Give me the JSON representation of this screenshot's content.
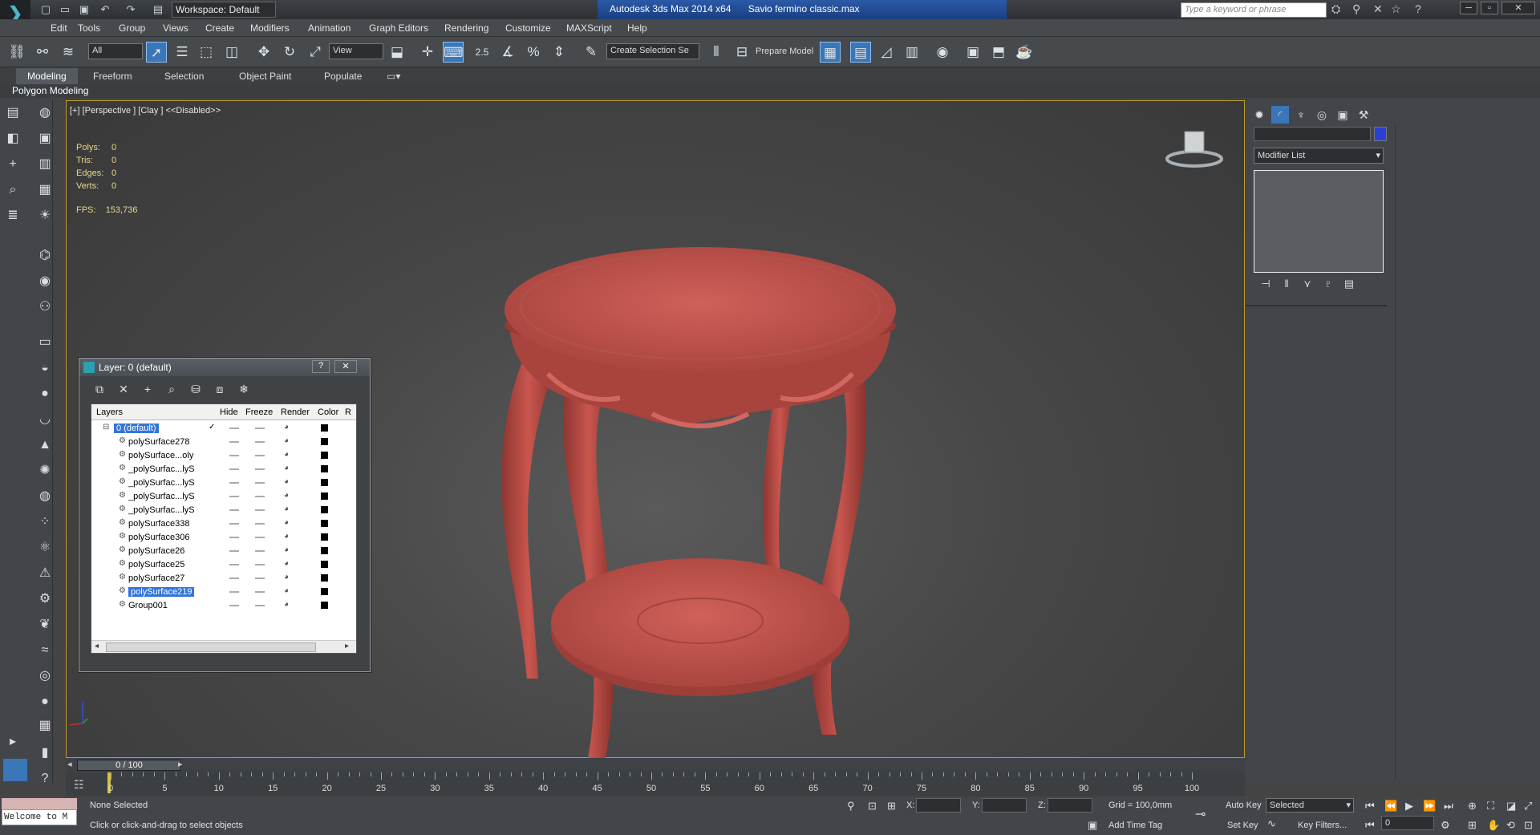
{
  "window": {
    "app_title": "Autodesk 3ds Max  2014 x64",
    "file_name": "Savio fermino classic.max",
    "workspace": "Workspace: Default",
    "search_placeholder": "Type a keyword or phrase"
  },
  "menu": [
    "Edit",
    "Tools",
    "Group",
    "Views",
    "Create",
    "Modifiers",
    "Animation",
    "Graph Editors",
    "Rendering",
    "Customize",
    "MAXScript",
    "Help"
  ],
  "toolbar": {
    "selection_filter": "All",
    "ref_coord": "View",
    "angle_snap": "2.5",
    "selection_set": "Create Selection Se",
    "prepare_model": "Prepare Model"
  },
  "ribbon": {
    "tabs": [
      "Modeling",
      "Freeform",
      "Selection",
      "Object Paint",
      "Populate"
    ],
    "active": "Modeling",
    "sub": "Polygon Modeling"
  },
  "viewport": {
    "label": "[+] [Perspective ] [Clay ]  <<Disabled>>",
    "stats": [
      {
        "k": "Polys:",
        "v": "0"
      },
      {
        "k": "Tris:",
        "v": "0"
      },
      {
        "k": "Edges:",
        "v": "0"
      },
      {
        "k": "Verts:",
        "v": "0"
      }
    ],
    "fps_label": "FPS:",
    "fps_value": "153,736",
    "object_color": "#c2504a"
  },
  "layer_window": {
    "title": "Layer: 0 (default)",
    "help": "?",
    "close": "✕",
    "columns": [
      "Layers",
      "Hide",
      "Freeze",
      "Render",
      "Color",
      "R"
    ],
    "rows": [
      {
        "name": "0 (default)",
        "selected": true,
        "check": "✓"
      },
      {
        "name": "polySurface278"
      },
      {
        "name": "polySurface...oly"
      },
      {
        "name": "_polySurfac...lyS"
      },
      {
        "name": "_polySurfac...lyS"
      },
      {
        "name": "_polySurfac...lyS"
      },
      {
        "name": "_polySurfac...lyS"
      },
      {
        "name": "polySurface338"
      },
      {
        "name": "polySurface306"
      },
      {
        "name": "polySurface26"
      },
      {
        "name": "polySurface25"
      },
      {
        "name": "polySurface27"
      },
      {
        "name": "polySurface219",
        "selected": true
      },
      {
        "name": "Group001"
      }
    ]
  },
  "command_panel": {
    "modifier_list": "Modifier List",
    "object_color": "#2a3fd6"
  },
  "timeline": {
    "slider": "0 / 100",
    "ticks": [
      "0",
      "5",
      "10",
      "15",
      "20",
      "25",
      "30",
      "35",
      "40",
      "45",
      "50",
      "55",
      "60",
      "65",
      "70",
      "75",
      "80",
      "85",
      "90",
      "95",
      "100"
    ]
  },
  "status": {
    "welcome": "Welcome to M",
    "selection": "None Selected",
    "prompt": "Click or click-and-drag to select objects",
    "x_label": "X:",
    "y_label": "Y:",
    "z_label": "Z:",
    "grid": "Grid = 100,0mm",
    "add_time_tag": "Add Time Tag",
    "auto_key": "Auto Key",
    "set_key": "Set Key",
    "key_mode": "Selected",
    "key_filters": "Key Filters...",
    "frame": "0"
  }
}
